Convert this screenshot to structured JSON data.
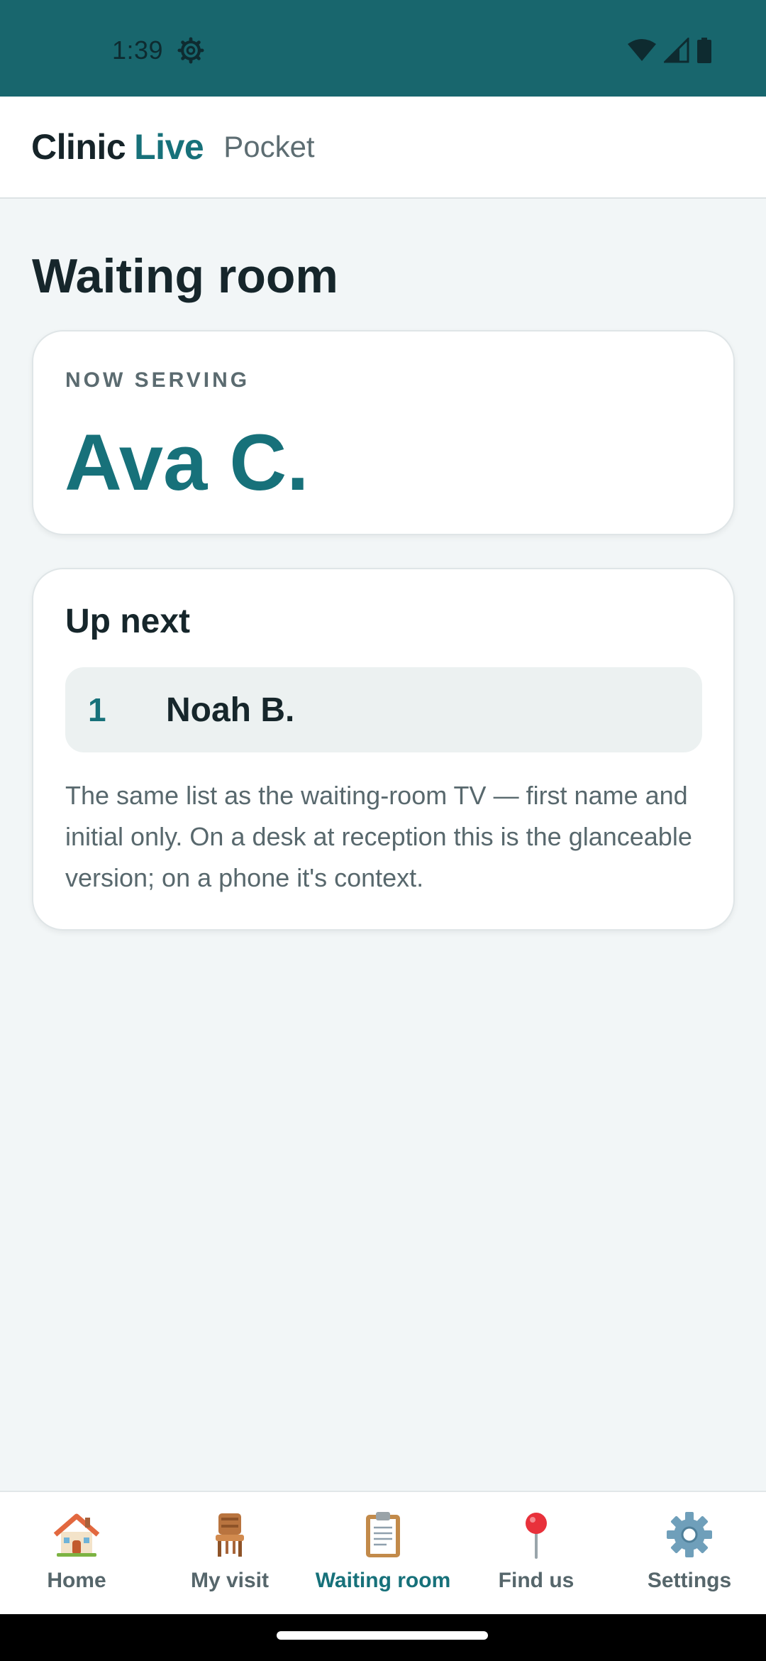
{
  "status_bar": {
    "time": "1:39",
    "icons": [
      "settings-gear-icon",
      "wifi-icon",
      "cellular-signal-icon",
      "battery-icon"
    ]
  },
  "app_bar": {
    "brand_primary": "Clinic",
    "brand_accent": "Live",
    "brand_suffix": "Pocket"
  },
  "page": {
    "title": "Waiting room"
  },
  "now_serving": {
    "label": "NOW SERVING",
    "name": "Ava C."
  },
  "up_next": {
    "title": "Up next",
    "queue": [
      {
        "position": "1",
        "name": "Noah B."
      }
    ],
    "description": "The same list as the waiting-room TV — first name and initial only. On a desk at reception this is the glanceable version; on a phone it's context."
  },
  "bottom_nav": {
    "items": [
      {
        "label": "Home",
        "icon": "house-icon",
        "active": false
      },
      {
        "label": "My visit",
        "icon": "chair-icon",
        "active": false
      },
      {
        "label": "Waiting room",
        "icon": "clipboard-icon",
        "active": true
      },
      {
        "label": "Find us",
        "icon": "location-pin-icon",
        "active": false
      },
      {
        "label": "Settings",
        "icon": "gear-icon",
        "active": false
      }
    ]
  },
  "colors": {
    "status_bar": "#18666d",
    "accent": "#17717a",
    "background": "#f2f6f7",
    "text_primary": "#16262b",
    "text_secondary": "#58686d"
  }
}
